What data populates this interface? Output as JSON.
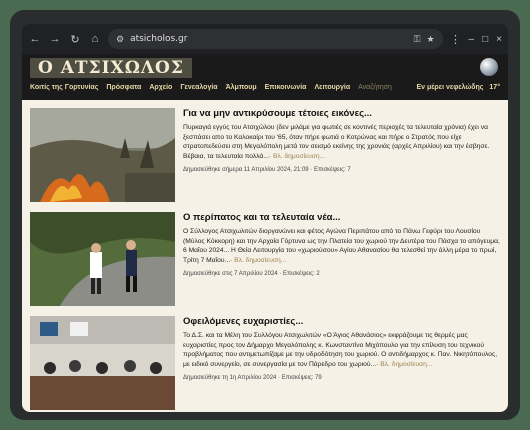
{
  "browser": {
    "url": "atsicholos.gr",
    "back_icon": "arrow-left-icon",
    "forward_icon": "arrow-right-icon",
    "reload_icon": "reload-icon",
    "home_icon": "home-icon"
  },
  "site": {
    "logo": "Ο ΑΤΣΙΧΩΛΟΣ",
    "nav": [
      "Κοιτίς της Γορτυνίας",
      "Πρόσφατα",
      "Αρχείο",
      "Γενεαλογία",
      "Άλμπουμ",
      "Επικοινωνία",
      "Λειτουργία",
      "Αναζήτηση"
    ],
    "weather": "Εν μέρει νεφελώδης",
    "temp": "17°"
  },
  "articles": [
    {
      "title": "Για να μην αντικρύσουμε τέτοιες εικόνες...",
      "text": "Πυρκαγιά εγγύς του Ατσιχώλου (δεν μιλάμε για φωτιές σε κοντινές περιοχές τα τελευταία χρόνια) έχει να ξεσπάσει απο το Καλοκαίρι του '65, όταν πήρε φωτιά ο Κοτρώνας και πήρε ο Στρατός που είχε στρατοπεδεύσει στη Μεγαλόπολη μετά τον σεισμό εκείνης της χρονιάς (αρχές Απριλίου) και την έσβησε. Βέβαια, τα τελευταία πολλά...",
      "more": "- Βλ. δημοσίευση...",
      "meta": "Δημοσιεύθηκε σήμερα 11 Απριλίου 2024, 21:09 · Επισκέψεις: 7"
    },
    {
      "title": "Ο περίπατος και τα τελευταία νέα...",
      "text": "Ο Σύλλογος Ατσιχωλιτών διοργανώνει και φέτος Αγώνα Περιπάτου από το Πάνω Γεφύρι του Λουσίου (Μύλος Κόκκορη) και την Αρχαία Γόρτυνα ως την Πλατεία του χωριού την Δευτέρα του Πάσχα το απόγευμα, 6 Μαΐου 2024... Η Θεία Λειτουργία του «χωριούσου» Αγίου Αθανασίου θα τελεσθεί την άλλη μέρα το πρωί, Τρίτη 7 Μαΐου...",
      "more": "- Βλ. δημοσίευση...",
      "meta": "Δημοσιεύθηκε στις 7 Απριλίου 2024 · Επισκέψεις: 2"
    },
    {
      "title": "Οφειλόμενες ευχαριστίες...",
      "text": "Το Δ.Σ. και τα Μέλη του Συλλόγου Ατσιχωλιτών «Ο Άγιος Αθανάσιος» εκφράζουμε τις θερμές μας ευχαριστίες προς τον Δήμαρχο Μεγαλόπολης κ. Κωνσταντίνο Μιχόπουλο για την επίλυση του τεχνικού προβλήματος που αντιμετωπίζαμε με την υδροδότηση του χωριού. Ο αντιδήμαρχος κ. Παν. Νικητόπουλος, με ειδικό συνεργείο, σε συνεργασία με τον Πάρεδρο του χωριού...",
      "more": "- Βλ. δημοσίευση...",
      "meta": "Δημοσιεύθηκε τη 1η Απριλίου 2024 · Επισκέψεις: 79"
    }
  ]
}
